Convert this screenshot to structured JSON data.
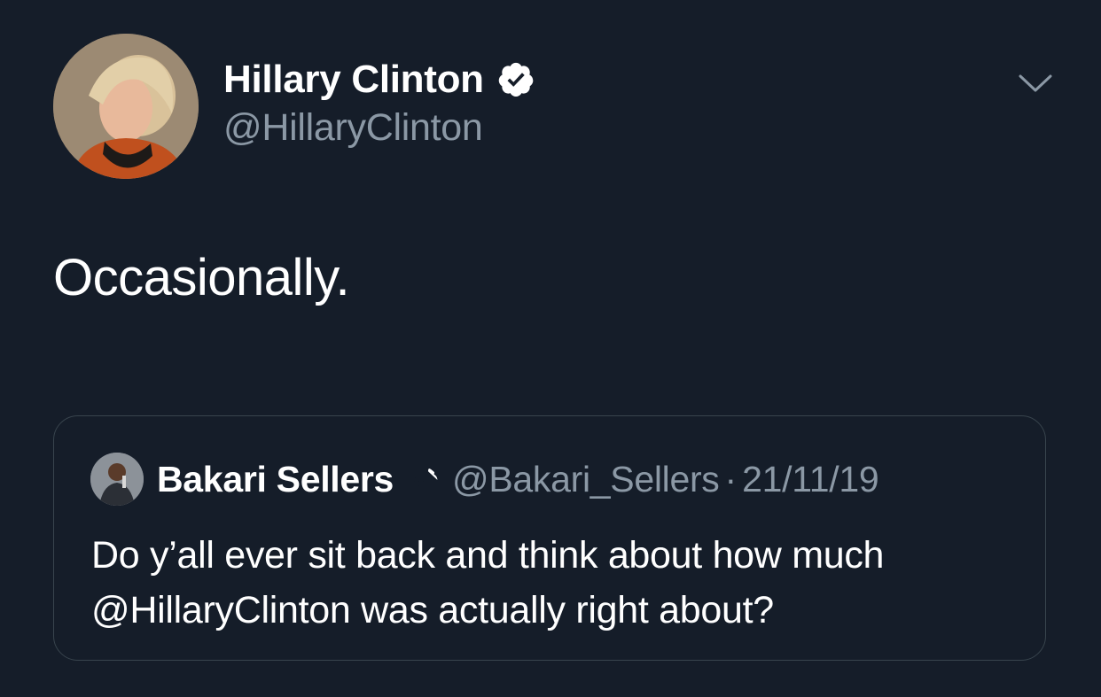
{
  "tweet": {
    "author": {
      "name": "Hillary Clinton",
      "handle": "@HillaryClinton",
      "verified": true
    },
    "text": "Occasionally.",
    "menu_icon": "chevron-down-icon"
  },
  "quoted_tweet": {
    "author": {
      "name": "Bakari Sellers",
      "handle": "@Bakari_Sellers",
      "verified": true
    },
    "separator": "·",
    "date": "21/11/19",
    "text": "Do y’all ever sit back and think about how much @HillaryClinton was actually right about?"
  },
  "colors": {
    "background": "#151d29",
    "text_primary": "#ffffff",
    "text_secondary": "#8b98a5",
    "border": "#38444d"
  }
}
